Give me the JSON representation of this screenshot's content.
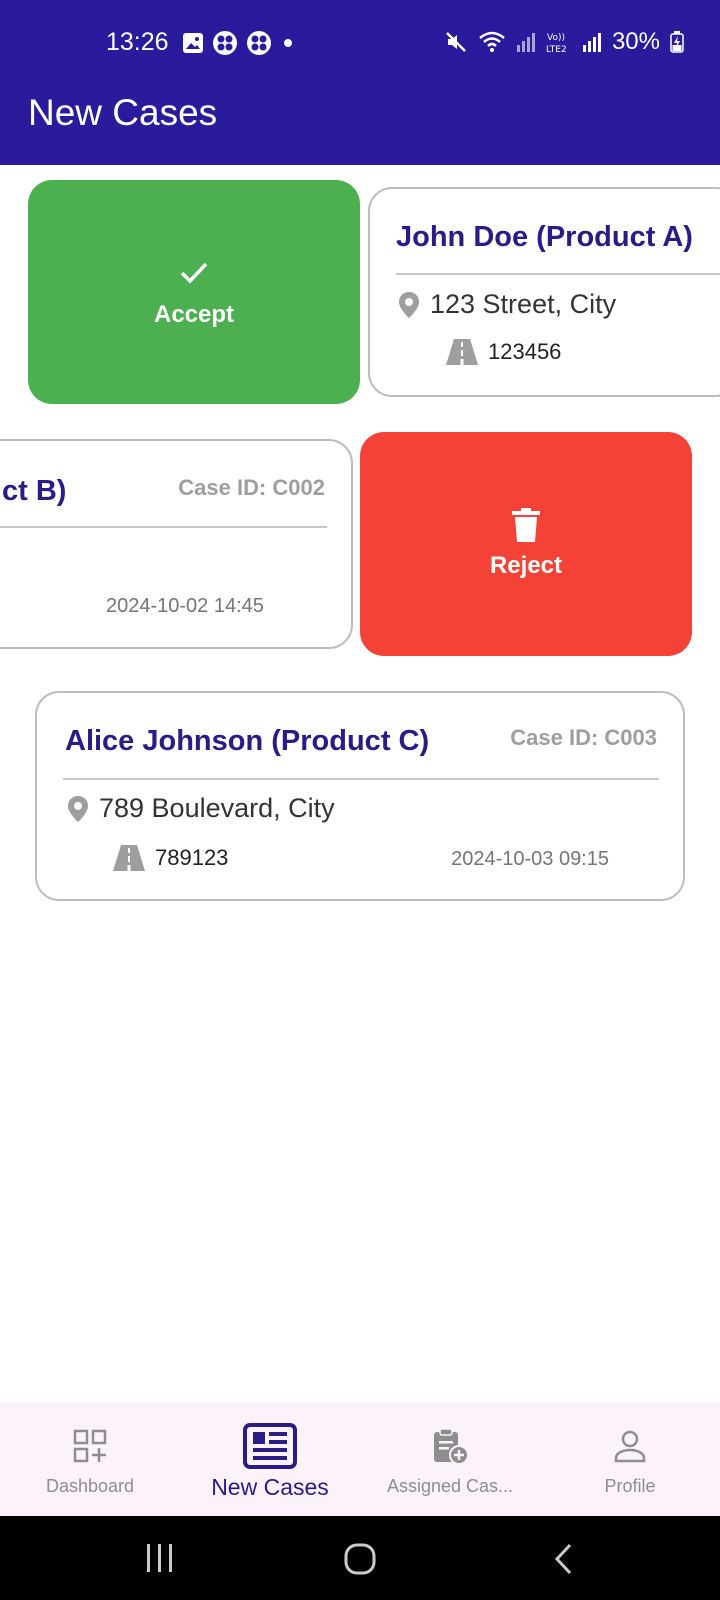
{
  "status_bar": {
    "time": "13:26",
    "battery": "30%"
  },
  "app_bar": {
    "title": "New Cases"
  },
  "actions": {
    "accept_label": "Accept",
    "reject_label": "Reject"
  },
  "cases": [
    {
      "title": "John Doe (Product A)",
      "address": "123 Street, City",
      "code": "123456"
    },
    {
      "title": "ct B)",
      "case_id": "Case ID: C002",
      "date": "2024-10-02 14:45"
    },
    {
      "title": "Alice Johnson (Product C)",
      "case_id": "Case ID: C003",
      "address": "789 Boulevard, City",
      "code": "789123",
      "date": "2024-10-03 09:15"
    }
  ],
  "bottom_nav": [
    {
      "label": "Dashboard",
      "icon": "dashboard-icon"
    },
    {
      "label": "New Cases",
      "icon": "newspaper-icon"
    },
    {
      "label": "Assigned Cas...",
      "icon": "clipboard-add-icon"
    },
    {
      "label": "Profile",
      "icon": "person-icon"
    }
  ],
  "colors": {
    "primary": "#2A1B9C",
    "accept": "#4CAF50",
    "reject": "#F44336",
    "muted": "#9E9E9E"
  }
}
